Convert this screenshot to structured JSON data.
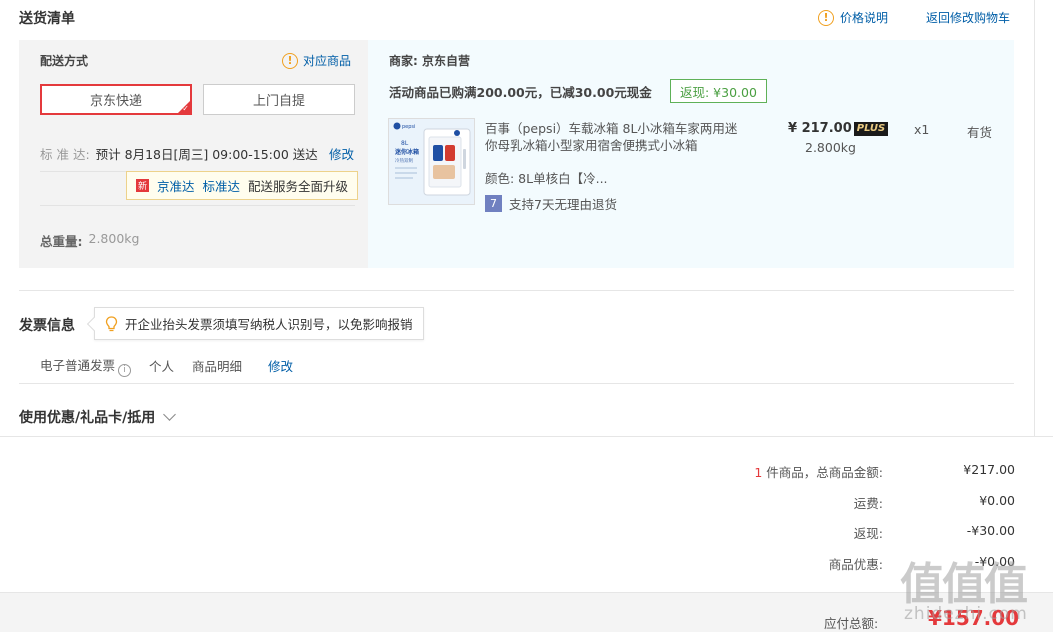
{
  "header": {
    "title": "送货清单",
    "price_info": "价格说明",
    "back_to_cart": "返回修改购物车"
  },
  "shipping": {
    "label": "配送方式",
    "match_goods": "对应商品",
    "options": [
      "京东快递",
      "上门自提"
    ],
    "eta_label": "标 准 达:",
    "eta_value": "预计 8月18日[周三] 09:00-15:00 送达",
    "eta_edit": "修改",
    "tip_new": "新",
    "tip_a": "京准达",
    "tip_b": "标准达",
    "tip_text": "配送服务全面升级",
    "weight_label": "总重量:",
    "weight_value": "2.800kg"
  },
  "goods": {
    "seller": "商家:  京东自营",
    "promo": "活动商品已购满200.00元，已减30.00元现金",
    "rebate": "返现:  ¥30.00",
    "thumb_brand": "pepsi",
    "thumb_line1": "8L",
    "thumb_line2": "迷你冰箱",
    "thumb_line3": "冷热双制",
    "name": "百事（pepsi）车载冰箱 8L小冰箱车家两用迷你母乳冰箱小型家用宿舍便携式小冰箱",
    "color": "颜色:  8L单核白【冷...",
    "return_badge": "7",
    "return_text": "支持7天无理由退货",
    "price": "¥ 217.00",
    "plus": "PLUS",
    "weight": "2.800kg",
    "qty": "x1",
    "stock": "有货"
  },
  "invoice": {
    "title": "发票信息",
    "tip": "开企业抬头发票须填写纳税人识别号，以免影响报销",
    "type": "电子普通发票",
    "q": "i",
    "person": "个人",
    "detail": "商品明细",
    "edit": "修改"
  },
  "coupon": {
    "title": "使用优惠/礼品卡/抵用"
  },
  "summary": {
    "count": "1",
    "total_label": "件商品，总商品金额:",
    "total_value": "¥217.00",
    "freight_label": "运费:",
    "freight_value": "¥0.00",
    "rebate_label": "返现:",
    "rebate_value": "-¥30.00",
    "discount_label": "商品优惠:",
    "discount_value": "-¥0.00",
    "pay_label": "应付总额:",
    "pay_value": "¥157.00"
  },
  "watermark": {
    "main": "值值值",
    "sub": "zhidezhi.com"
  },
  "colors": {
    "accent_red": "#e4393c",
    "link_blue": "#005ea7",
    "rebate_green": "#4a9f41"
  }
}
